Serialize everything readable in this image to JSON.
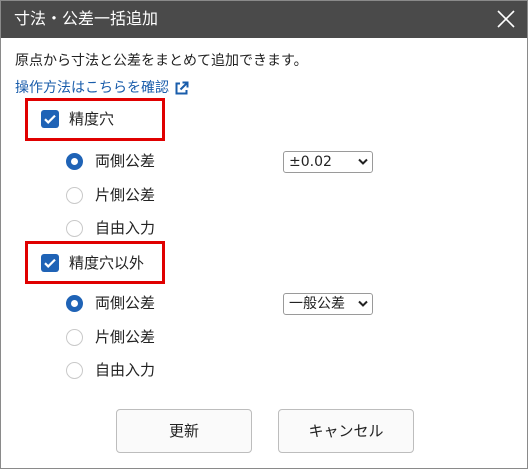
{
  "dialog": {
    "title": "寸法・公差一括追加",
    "intro": "原点から寸法と公差をまとめて追加できます。",
    "help_link": "操作方法はこちらを確認"
  },
  "precision_hole": {
    "label": "精度穴",
    "checked": true,
    "options": [
      "両側公差",
      "片側公差",
      "自由入力"
    ],
    "selected_option": "両側公差",
    "tolerance_value": "±0.02"
  },
  "other": {
    "label": "精度穴以外",
    "checked": true,
    "options": [
      "両側公差",
      "片側公差",
      "自由入力"
    ],
    "selected_option": "両側公差",
    "tolerance_value": "一般公差"
  },
  "buttons": {
    "update": "更新",
    "cancel": "キャンセル"
  },
  "colors": {
    "titlebar": "#4a4a4a",
    "accent": "#1f63b6",
    "highlight_box": "#e00000",
    "link": "#1a5dab"
  }
}
